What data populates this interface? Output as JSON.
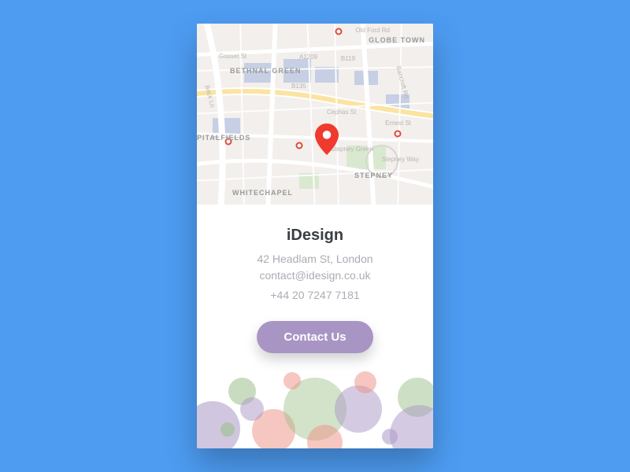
{
  "company": {
    "name": "iDesign",
    "address": "42 Headlam St, London",
    "email": "contact@idesign.co.uk",
    "phone": "+44 20 7247 7181"
  },
  "cta": {
    "label": "Contact Us"
  },
  "map": {
    "pin_icon": "location-pin",
    "labels": {
      "bethnal_green": "BETHNAL GREEN",
      "globe_town": "GLOBE TOWN",
      "spitalfields": "PITALFIELDS",
      "whitechapel": "WHITECHAPEL",
      "stepney": "STEPNEY"
    },
    "roads": {
      "old_ford": "Old Ford Rd",
      "gosset": "Gosset St",
      "cephas": "Cephas St",
      "ernest": "Ernest St",
      "a1209": "A1209",
      "b119": "B119",
      "b135": "B135",
      "brick_ln": "Brick Ln",
      "stepney_way": "Stepney Way",
      "bancroft": "Bancroft Rd",
      "stepney_green": "Stepney Green"
    }
  },
  "colors": {
    "background": "#4d9cf2",
    "accent": "#a895c4",
    "pin": "#ef3a2d"
  }
}
